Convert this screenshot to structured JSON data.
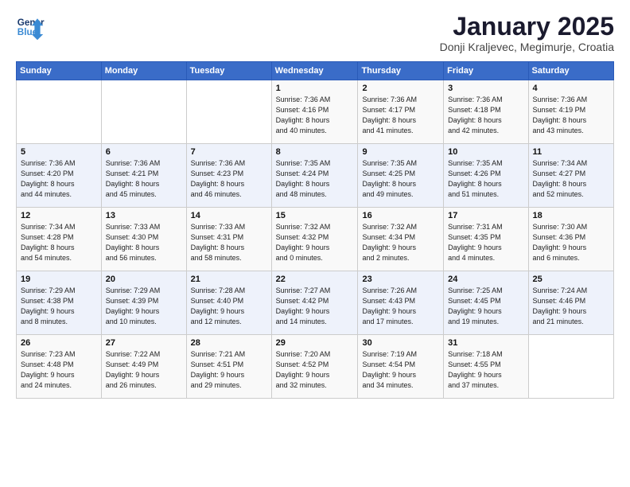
{
  "header": {
    "logo_line1": "General",
    "logo_line2": "Blue",
    "title": "January 2025",
    "subtitle": "Donji Kraljevec, Megimurje, Croatia"
  },
  "columns": [
    "Sunday",
    "Monday",
    "Tuesday",
    "Wednesday",
    "Thursday",
    "Friday",
    "Saturday"
  ],
  "weeks": [
    [
      {
        "day": "",
        "detail": ""
      },
      {
        "day": "",
        "detail": ""
      },
      {
        "day": "",
        "detail": ""
      },
      {
        "day": "1",
        "detail": "Sunrise: 7:36 AM\nSunset: 4:16 PM\nDaylight: 8 hours\nand 40 minutes."
      },
      {
        "day": "2",
        "detail": "Sunrise: 7:36 AM\nSunset: 4:17 PM\nDaylight: 8 hours\nand 41 minutes."
      },
      {
        "day": "3",
        "detail": "Sunrise: 7:36 AM\nSunset: 4:18 PM\nDaylight: 8 hours\nand 42 minutes."
      },
      {
        "day": "4",
        "detail": "Sunrise: 7:36 AM\nSunset: 4:19 PM\nDaylight: 8 hours\nand 43 minutes."
      }
    ],
    [
      {
        "day": "5",
        "detail": "Sunrise: 7:36 AM\nSunset: 4:20 PM\nDaylight: 8 hours\nand 44 minutes."
      },
      {
        "day": "6",
        "detail": "Sunrise: 7:36 AM\nSunset: 4:21 PM\nDaylight: 8 hours\nand 45 minutes."
      },
      {
        "day": "7",
        "detail": "Sunrise: 7:36 AM\nSunset: 4:23 PM\nDaylight: 8 hours\nand 46 minutes."
      },
      {
        "day": "8",
        "detail": "Sunrise: 7:35 AM\nSunset: 4:24 PM\nDaylight: 8 hours\nand 48 minutes."
      },
      {
        "day": "9",
        "detail": "Sunrise: 7:35 AM\nSunset: 4:25 PM\nDaylight: 8 hours\nand 49 minutes."
      },
      {
        "day": "10",
        "detail": "Sunrise: 7:35 AM\nSunset: 4:26 PM\nDaylight: 8 hours\nand 51 minutes."
      },
      {
        "day": "11",
        "detail": "Sunrise: 7:34 AM\nSunset: 4:27 PM\nDaylight: 8 hours\nand 52 minutes."
      }
    ],
    [
      {
        "day": "12",
        "detail": "Sunrise: 7:34 AM\nSunset: 4:28 PM\nDaylight: 8 hours\nand 54 minutes."
      },
      {
        "day": "13",
        "detail": "Sunrise: 7:33 AM\nSunset: 4:30 PM\nDaylight: 8 hours\nand 56 minutes."
      },
      {
        "day": "14",
        "detail": "Sunrise: 7:33 AM\nSunset: 4:31 PM\nDaylight: 8 hours\nand 58 minutes."
      },
      {
        "day": "15",
        "detail": "Sunrise: 7:32 AM\nSunset: 4:32 PM\nDaylight: 9 hours\nand 0 minutes."
      },
      {
        "day": "16",
        "detail": "Sunrise: 7:32 AM\nSunset: 4:34 PM\nDaylight: 9 hours\nand 2 minutes."
      },
      {
        "day": "17",
        "detail": "Sunrise: 7:31 AM\nSunset: 4:35 PM\nDaylight: 9 hours\nand 4 minutes."
      },
      {
        "day": "18",
        "detail": "Sunrise: 7:30 AM\nSunset: 4:36 PM\nDaylight: 9 hours\nand 6 minutes."
      }
    ],
    [
      {
        "day": "19",
        "detail": "Sunrise: 7:29 AM\nSunset: 4:38 PM\nDaylight: 9 hours\nand 8 minutes."
      },
      {
        "day": "20",
        "detail": "Sunrise: 7:29 AM\nSunset: 4:39 PM\nDaylight: 9 hours\nand 10 minutes."
      },
      {
        "day": "21",
        "detail": "Sunrise: 7:28 AM\nSunset: 4:40 PM\nDaylight: 9 hours\nand 12 minutes."
      },
      {
        "day": "22",
        "detail": "Sunrise: 7:27 AM\nSunset: 4:42 PM\nDaylight: 9 hours\nand 14 minutes."
      },
      {
        "day": "23",
        "detail": "Sunrise: 7:26 AM\nSunset: 4:43 PM\nDaylight: 9 hours\nand 17 minutes."
      },
      {
        "day": "24",
        "detail": "Sunrise: 7:25 AM\nSunset: 4:45 PM\nDaylight: 9 hours\nand 19 minutes."
      },
      {
        "day": "25",
        "detail": "Sunrise: 7:24 AM\nSunset: 4:46 PM\nDaylight: 9 hours\nand 21 minutes."
      }
    ],
    [
      {
        "day": "26",
        "detail": "Sunrise: 7:23 AM\nSunset: 4:48 PM\nDaylight: 9 hours\nand 24 minutes."
      },
      {
        "day": "27",
        "detail": "Sunrise: 7:22 AM\nSunset: 4:49 PM\nDaylight: 9 hours\nand 26 minutes."
      },
      {
        "day": "28",
        "detail": "Sunrise: 7:21 AM\nSunset: 4:51 PM\nDaylight: 9 hours\nand 29 minutes."
      },
      {
        "day": "29",
        "detail": "Sunrise: 7:20 AM\nSunset: 4:52 PM\nDaylight: 9 hours\nand 32 minutes."
      },
      {
        "day": "30",
        "detail": "Sunrise: 7:19 AM\nSunset: 4:54 PM\nDaylight: 9 hours\nand 34 minutes."
      },
      {
        "day": "31",
        "detail": "Sunrise: 7:18 AM\nSunset: 4:55 PM\nDaylight: 9 hours\nand 37 minutes."
      },
      {
        "day": "",
        "detail": ""
      }
    ]
  ]
}
